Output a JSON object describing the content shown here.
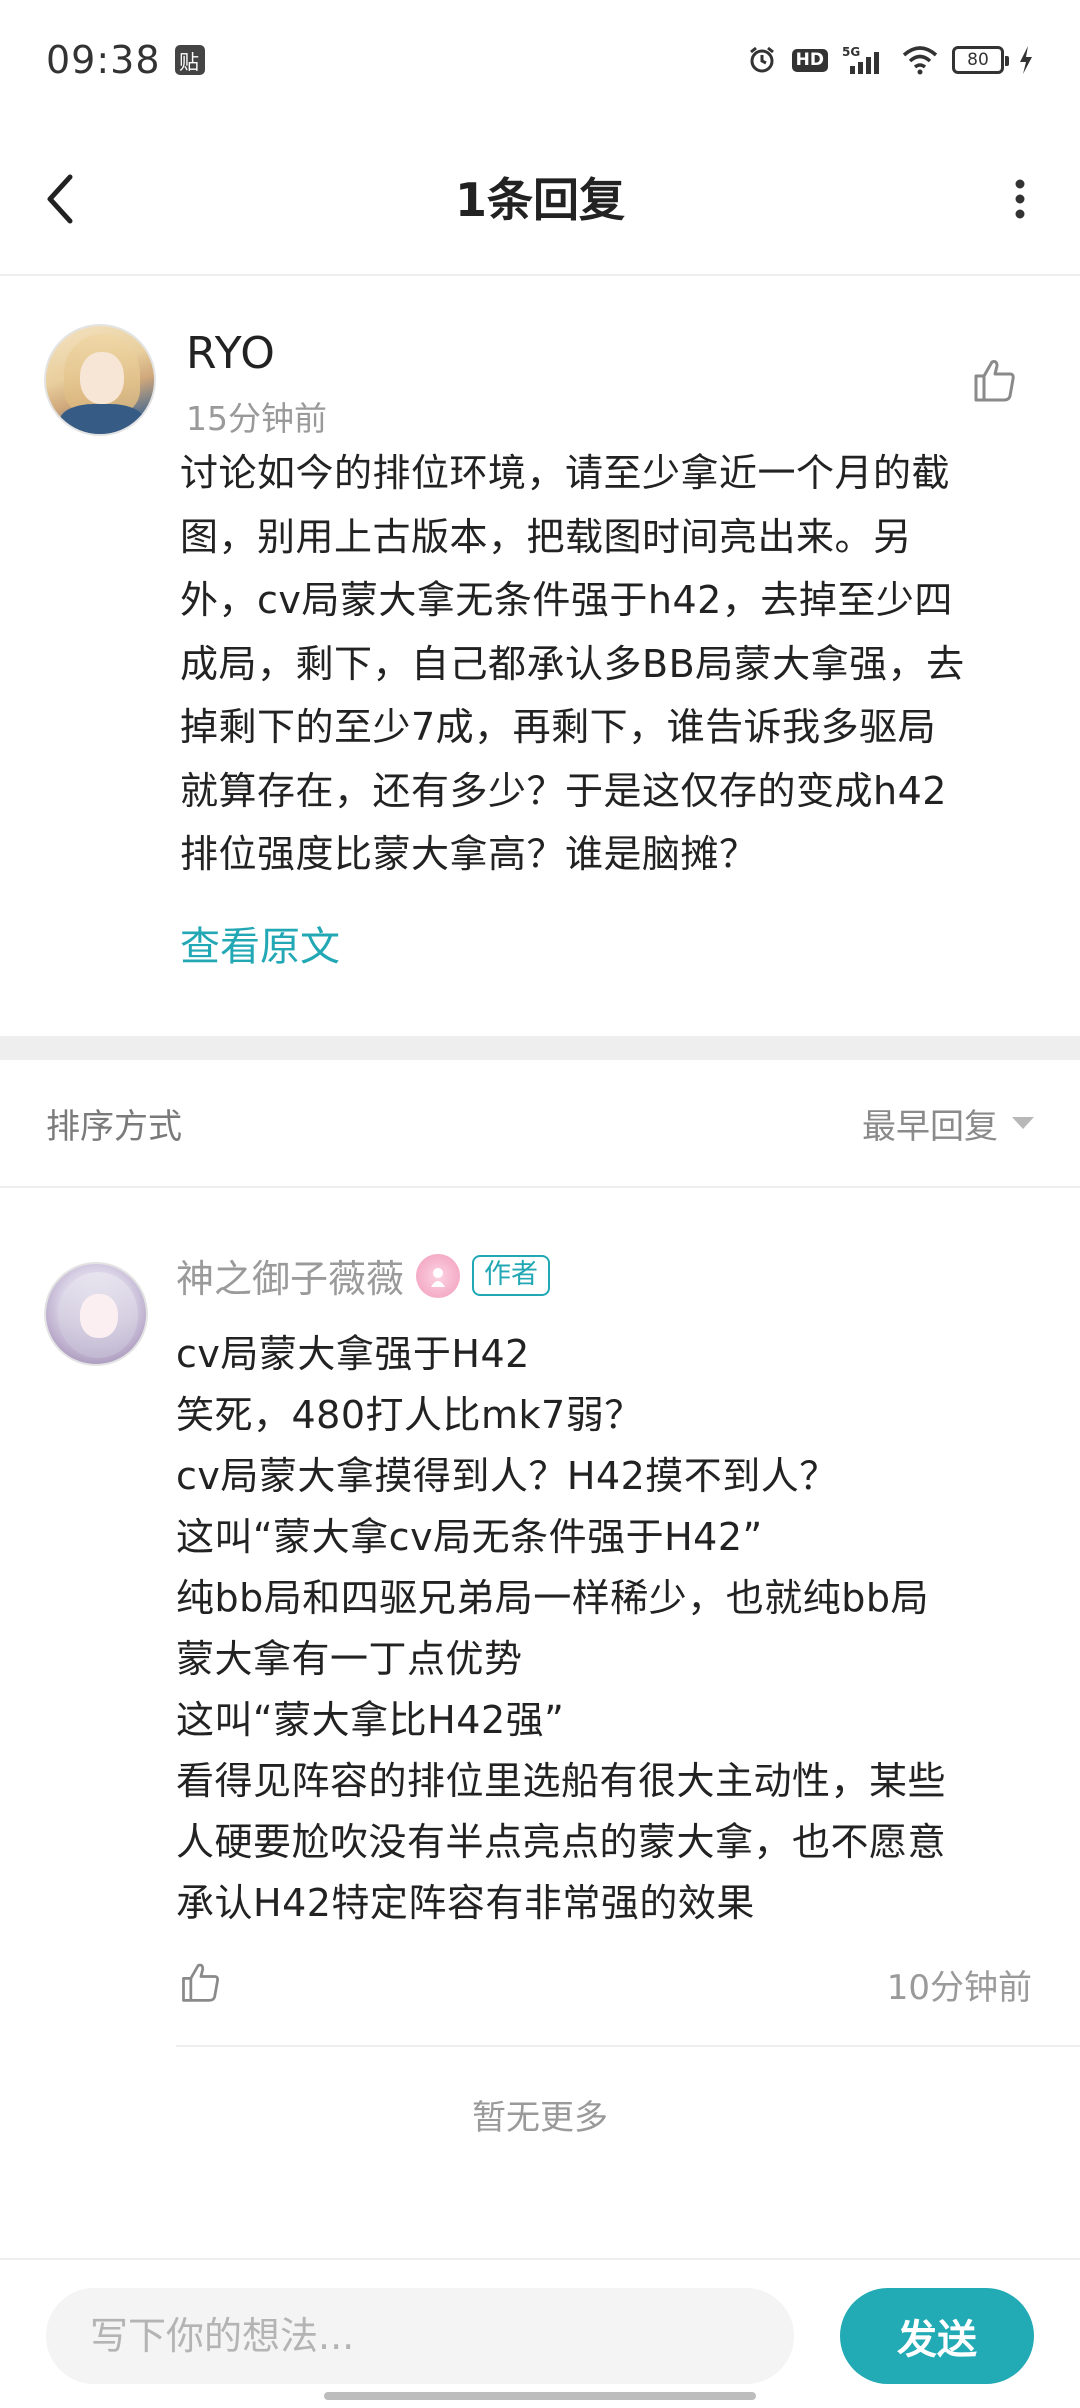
{
  "status_bar": {
    "time": "09:38",
    "paste_badge": "贴",
    "hd_label": "HD",
    "network_label": "5G",
    "battery_level": "80"
  },
  "nav": {
    "title": "1条回复"
  },
  "main_comment": {
    "username": "RYO",
    "time_ago": "15分钟前",
    "content_lines": [
      "讨论如今的排位环境，请至少拿近一个月的截",
      "图，别用上古版本，把载图时间亮出来。另",
      "外，cv局蒙大拿无条件强于h42，去掉至少四",
      "成局，剩下，自己都承认多BB局蒙大拿强，去",
      "掉剩下的至少7成，再剩下，谁告诉我多驱局",
      "就算存在，还有多少？于是这仅存的变成h42",
      "排位强度比蒙大拿高？谁是脑摊？"
    ],
    "view_original": "查看原文"
  },
  "sort": {
    "label": "排序方式",
    "selected": "最早回复"
  },
  "reply": {
    "username": "神之御子薇薇",
    "author_badge": "作者",
    "content_lines": [
      "cv局蒙大拿强于H42",
      "笑死，480打人比mk7弱？",
      "cv局蒙大拿摸得到人？H42摸不到人？",
      "这叫“蒙大拿cv局无条件强于H42”",
      "纯bb局和四驱兄弟局一样稀少，也就纯bb局",
      "蒙大拿有一丁点优势",
      "这叫“蒙大拿比H42强”",
      "看得见阵容的排位里选船有很大主动性，某些",
      "人硬要尬吹没有半点亮点的蒙大拿，也不愿意",
      "承认H42特定阵容有非常强的效果"
    ],
    "time_ago": "10分钟前"
  },
  "footer_note": "暂无更多",
  "compose": {
    "placeholder": "写下你的想法...",
    "send_label": "发送"
  },
  "colors": {
    "accent": "#22aab5",
    "text": "#222222",
    "muted": "#9a9a9a",
    "divider": "#eeeeee"
  }
}
